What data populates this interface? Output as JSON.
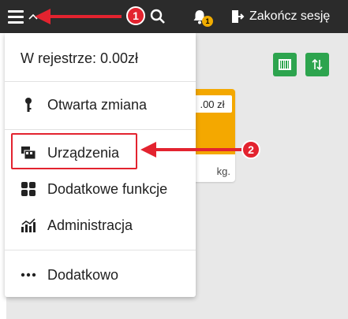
{
  "topbar": {
    "logout_label": "Zakończ sesję",
    "notification_count": "1"
  },
  "callouts": {
    "first": "1",
    "second": "2"
  },
  "menu": {
    "register_text": "W rejestrze: 0.00zł",
    "items": [
      {
        "label": "Otwarta zmiana",
        "icon": "key-icon"
      },
      {
        "label": "Urządzenia",
        "icon": "devices-icon"
      },
      {
        "label": "Dodatkowe funkcje",
        "icon": "grid-icon"
      },
      {
        "label": "Administracja",
        "icon": "chart-icon"
      },
      {
        "label": "Dodatkowo",
        "icon": "more-dots-icon"
      }
    ]
  },
  "product": {
    "price": ".00 zł",
    "unit": "kg."
  },
  "colors": {
    "topbar": "#2b2b2b",
    "accent_red": "#e3232f",
    "badge_yellow": "#f0ac00",
    "green": "#2da44e",
    "product_orange": "#f4a800"
  }
}
